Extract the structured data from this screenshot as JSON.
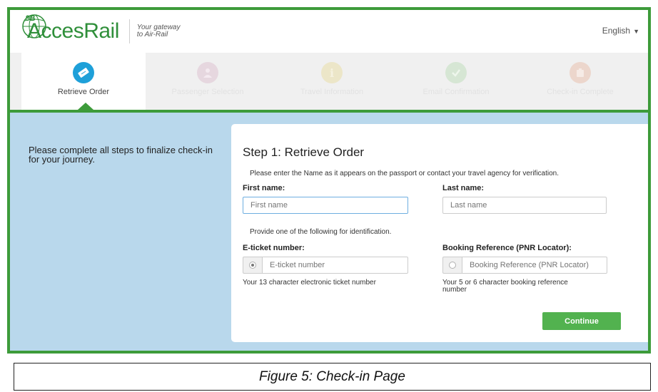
{
  "header": {
    "logo_badge": "9B",
    "logo_text": "AccesRail",
    "tagline_line1": "Your gateway",
    "tagline_line2": "to Air-Rail",
    "language": "English"
  },
  "steps": [
    {
      "label": "Retrieve Order",
      "icon": "ticket-icon",
      "active": true
    },
    {
      "label": "Passenger Selection",
      "icon": "person-icon",
      "active": false
    },
    {
      "label": "Travel Information",
      "icon": "info-icon",
      "active": false
    },
    {
      "label": "Email Confirmation",
      "icon": "check-icon",
      "active": false
    },
    {
      "label": "Check-in Complete",
      "icon": "luggage-icon",
      "active": false
    }
  ],
  "colors": {
    "brand_green": "#3d9b3a",
    "active_step": "#1ea0d9",
    "panel_blue": "#b9d8ec",
    "button_green": "#52b24f"
  },
  "intro_text": "Please complete all steps to finalize check-in for your journey.",
  "form": {
    "title": "Step 1: Retrieve Order",
    "instruction": "Please enter the Name as it appears on the passport or contact your travel agency for verification.",
    "first_name_label": "First name:",
    "first_name_placeholder": "First name",
    "last_name_label": "Last name:",
    "last_name_placeholder": "Last name",
    "identification_note": "Provide one of the following for identification.",
    "eticket_label": "E-ticket number:",
    "eticket_placeholder": "E-ticket number",
    "eticket_help": "Your 13 character electronic ticket number",
    "pnr_label": "Booking Reference (PNR Locator):",
    "pnr_placeholder": "Booking Reference (PNR Locator)",
    "pnr_help": "Your 5 or 6 character booking reference number",
    "continue_label": "Continue"
  },
  "caption": "Figure 5: Check-in Page"
}
